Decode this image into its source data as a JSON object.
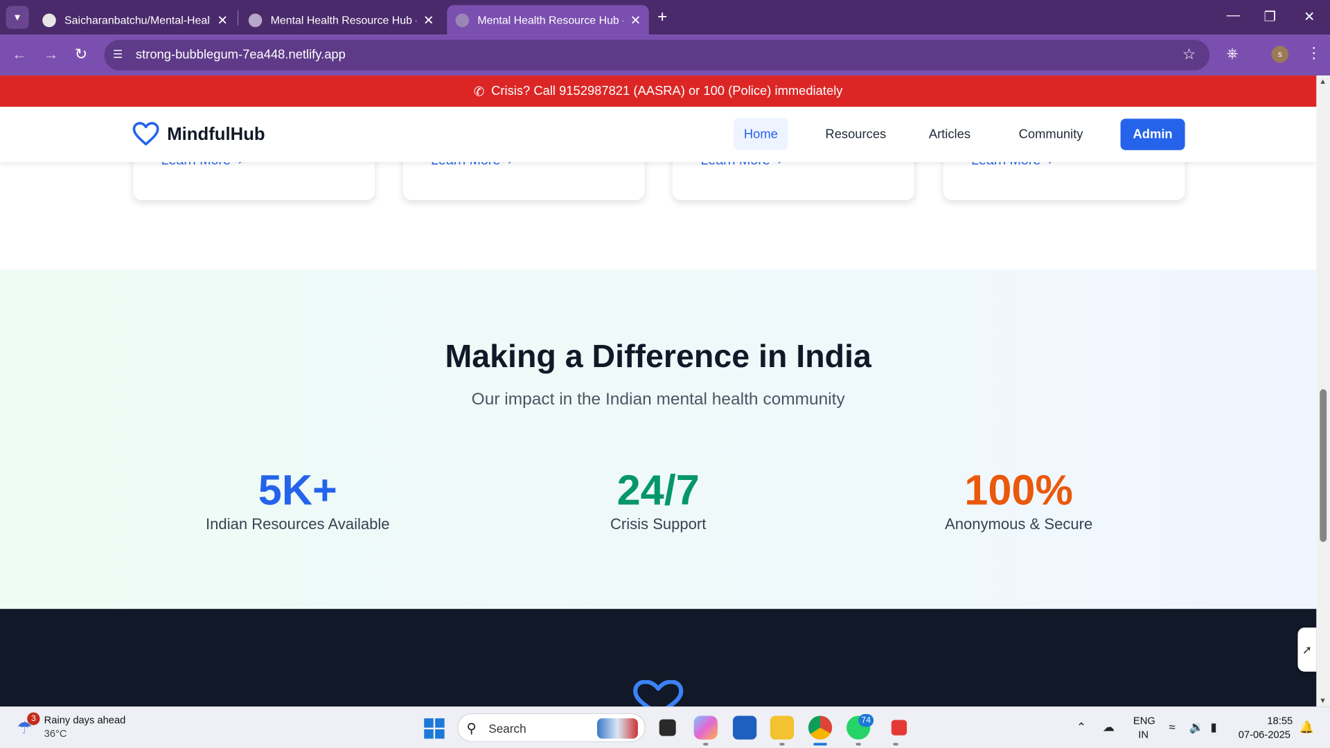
{
  "browser": {
    "tabs": [
      {
        "title": "Saicharanbatchu/Mental-Health",
        "active": false
      },
      {
        "title": "Mental Health Resource Hub - S",
        "active": false
      },
      {
        "title": "Mental Health Resource Hub - S",
        "active": true
      }
    ],
    "url": "strong-bubblegum-7ea448.netlify.app",
    "profile_initial": "s"
  },
  "crisis_banner": {
    "text": "Crisis? Call 9152987821 (AASRA) or 100 (Police) immediately"
  },
  "header": {
    "logo_text": "MindfulHub",
    "nav": [
      {
        "label": "Home",
        "active": true
      },
      {
        "label": "Resources",
        "active": false
      },
      {
        "label": "Articles",
        "active": false
      },
      {
        "label": "Community",
        "active": false
      }
    ],
    "admin_label": "Admin"
  },
  "cards": [
    {
      "link": "Learn More"
    },
    {
      "link": "Learn More"
    },
    {
      "link": "Learn More"
    },
    {
      "link": "Learn More"
    }
  ],
  "impact": {
    "title": "Making a Difference in India",
    "subtitle": "Our impact in the Indian mental health community",
    "stats": [
      {
        "value": "5K+",
        "label": "Indian Resources Available",
        "color": "#2563eb"
      },
      {
        "value": "24/7",
        "label": "Crisis Support",
        "color": "#059669"
      },
      {
        "value": "100%",
        "label": "Anonymous & Secure",
        "color": "#ea580c"
      }
    ]
  },
  "taskbar": {
    "weather_title": "Rainy days ahead",
    "weather_temp": "36°C",
    "weather_badge": "3",
    "search_label": "Search",
    "whatsapp_badge": "74",
    "lang_line1": "ENG",
    "lang_line2": "IN",
    "time": "18:55",
    "date": "07-06-2025"
  },
  "colors": {
    "brand": "#2563eb",
    "crisis": "#dc2626",
    "chrome": "#7b4fb0",
    "footer": "#111827"
  }
}
